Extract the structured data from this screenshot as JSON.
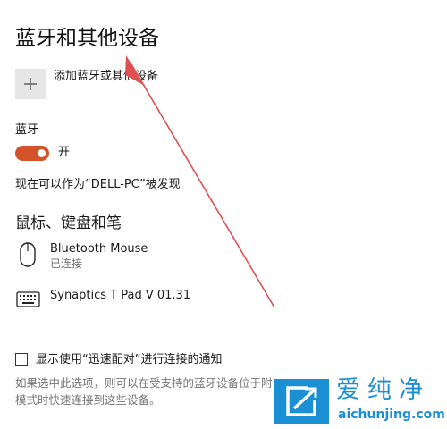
{
  "header": {
    "title": "蓝牙和其他设备"
  },
  "add_device": {
    "label": "添加蓝牙或其他设备"
  },
  "bluetooth": {
    "label": "蓝牙",
    "toggle_state": "开",
    "discoverable_text": "现在可以作为“DELL-PC”被发现"
  },
  "section": {
    "title": "鼠标、键盘和笔"
  },
  "devices": [
    {
      "name": "Bluetooth Mouse",
      "status": "已连接",
      "icon": "mouse-icon"
    },
    {
      "name": "Synaptics T Pad V 01.31",
      "status": "",
      "icon": "keyboard-icon"
    }
  ],
  "swift_pair": {
    "label": "显示使用“迅速配对”进行连接的通知",
    "checked": false,
    "description_line1": "如果选中此选项，则可以在受支持的蓝牙设备位于附",
    "description_line2": "模式时快速连接到这些设备。"
  },
  "watermark": {
    "name": "爱纯净",
    "url": "aichunjing.com",
    "logo_icon": "logo-icon"
  },
  "colors": {
    "accent": "#d4522a",
    "arrow": "#e05050",
    "watermark": "#1a8fd3",
    "muted_text": "#757575"
  }
}
